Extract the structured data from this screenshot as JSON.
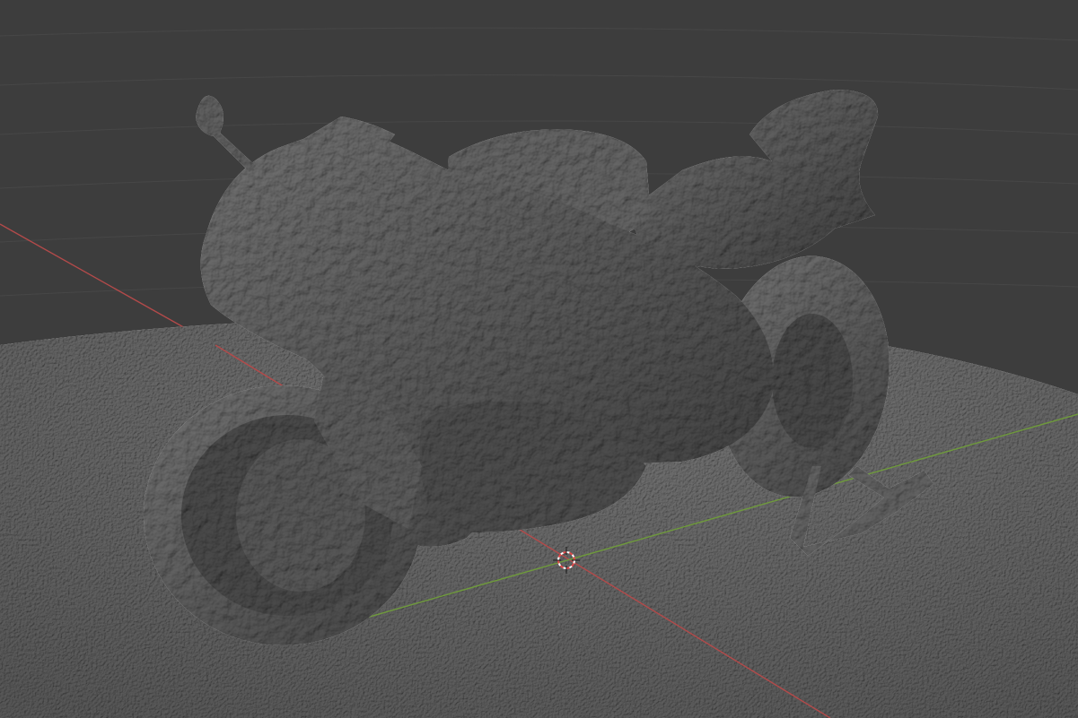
{
  "viewport": {
    "kind": "3D viewport",
    "background_color": "#3d3d3d",
    "grid_color": "#474747",
    "floor_color": "#6f6f6f",
    "model_color": "#777777",
    "x_axis_color": "#b34a4a",
    "y_axis_color": "#6f9b3b",
    "cursor_colors": [
      "#e04a4a",
      "#ffffff"
    ]
  },
  "scene": {
    "object": "motorcycle",
    "object_icon": "motorcycle-mesh",
    "surface": "ground-disc",
    "cursor_icon": "3d-cursor-icon"
  }
}
